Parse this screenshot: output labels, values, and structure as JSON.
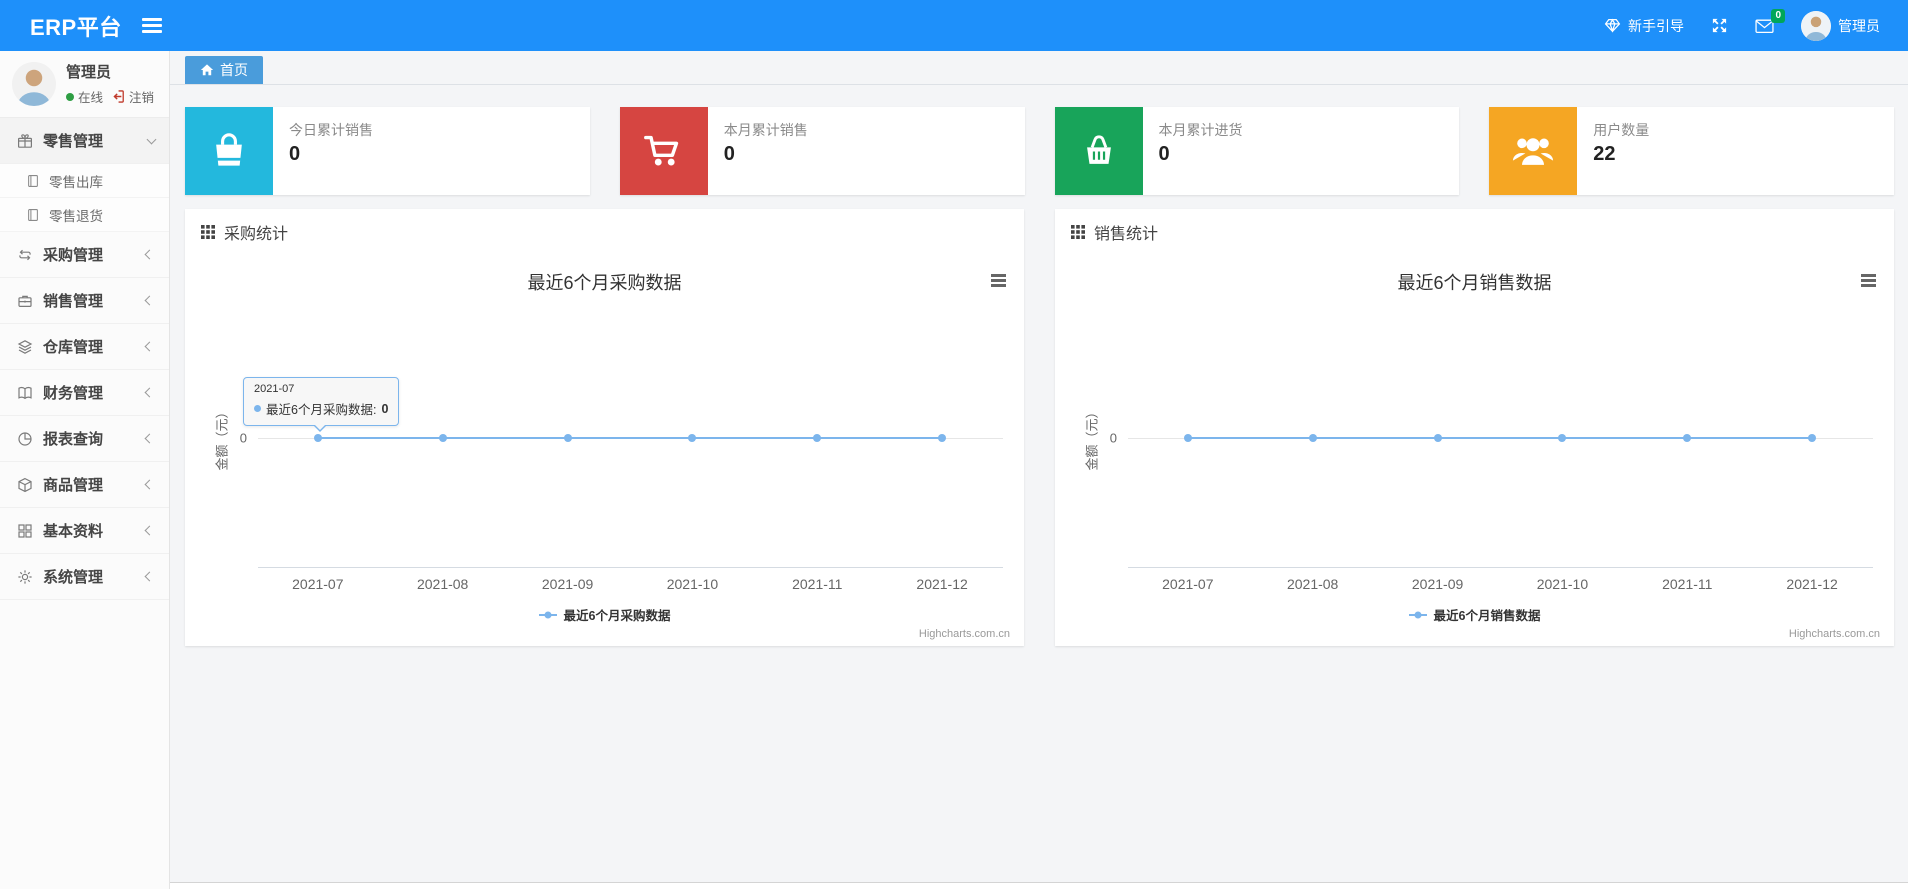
{
  "navbar": {
    "brand": "ERP平台",
    "guide": "新手引导",
    "mail_badge": "0",
    "username": "管理员"
  },
  "sidebar": {
    "user": {
      "name": "管理员",
      "status": "在线",
      "logout": "注销"
    },
    "menu": [
      {
        "label": "零售管理",
        "icon": "gift-icon",
        "state": "open",
        "children": [
          {
            "label": "零售出库"
          },
          {
            "label": "零售退货"
          }
        ]
      },
      {
        "label": "采购管理",
        "icon": "loop-icon"
      },
      {
        "label": "销售管理",
        "icon": "briefcase-icon"
      },
      {
        "label": "仓库管理",
        "icon": "layers-icon"
      },
      {
        "label": "财务管理",
        "icon": "ledger-icon"
      },
      {
        "label": "报表查询",
        "icon": "pie-chart-icon"
      },
      {
        "label": "商品管理",
        "icon": "box-icon"
      },
      {
        "label": "基本资料",
        "icon": "grid-icon"
      },
      {
        "label": "系统管理",
        "icon": "gear-icon"
      }
    ]
  },
  "tabs": {
    "home": "首页"
  },
  "stat_cards": [
    {
      "label": "今日累计销售",
      "value": "0",
      "color": "#23b8dd",
      "icon": "shopping-bag-icon"
    },
    {
      "label": "本月累计销售",
      "value": "0",
      "color": "#d64541",
      "icon": "cart-icon"
    },
    {
      "label": "本月累计进货",
      "value": "0",
      "color": "#18a45a",
      "icon": "basket-icon"
    },
    {
      "label": "用户数量",
      "value": "22",
      "color": "#f5a623",
      "icon": "users-icon"
    }
  ],
  "panels": [
    {
      "title": "采购统计"
    },
    {
      "title": "销售统计"
    }
  ],
  "chart_data": [
    {
      "type": "line",
      "title": "最近6个月采购数据",
      "categories": [
        "2021-07",
        "2021-08",
        "2021-09",
        "2021-10",
        "2021-11",
        "2021-12"
      ],
      "series": [
        {
          "name": "最近6个月采购数据",
          "values": [
            0,
            0,
            0,
            0,
            0,
            0
          ],
          "color": "#7cb5ec"
        }
      ],
      "ylabel": "金额（元）",
      "yticks": [
        "0"
      ],
      "ylim": [
        -1,
        1
      ],
      "grid": "single-zero-line",
      "legend_position": "bottom",
      "credit": "Highcharts.com.cn",
      "tooltip": {
        "visible": true,
        "category": "2021-07",
        "label": "最近6个月采购数据: ",
        "value": "0"
      }
    },
    {
      "type": "line",
      "title": "最近6个月销售数据",
      "categories": [
        "2021-07",
        "2021-08",
        "2021-09",
        "2021-10",
        "2021-11",
        "2021-12"
      ],
      "series": [
        {
          "name": "最近6个月销售数据",
          "values": [
            0,
            0,
            0,
            0,
            0,
            0
          ],
          "color": "#7cb5ec"
        }
      ],
      "ylabel": "金额（元）",
      "yticks": [
        "0"
      ],
      "ylim": [
        -1,
        1
      ],
      "grid": "single-zero-line",
      "legend_position": "bottom",
      "credit": "Highcharts.com.cn",
      "tooltip": {
        "visible": false
      }
    }
  ]
}
